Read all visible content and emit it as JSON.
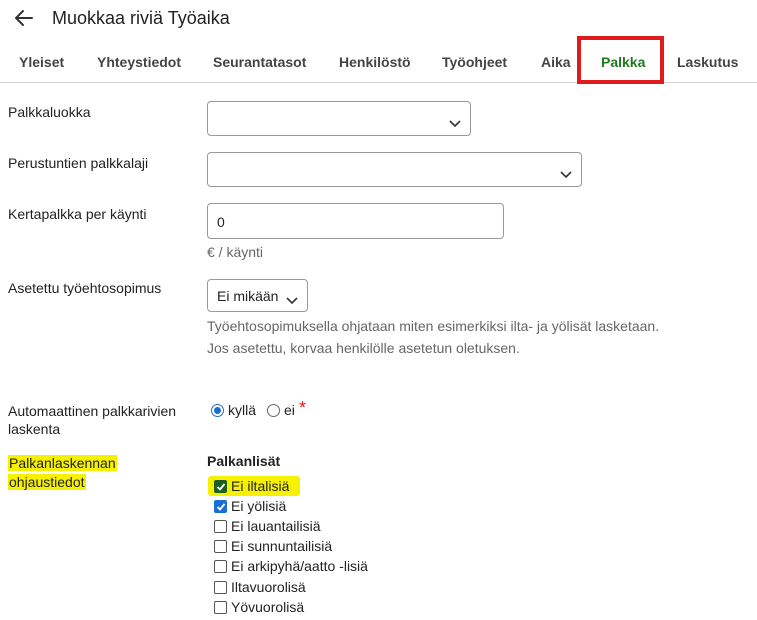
{
  "header": {
    "title": "Muokkaa riviä Työaika",
    "back_icon": "arrow-left-icon"
  },
  "tabs": [
    {
      "label": "Yleiset",
      "active": false
    },
    {
      "label": "Yhteystiedot",
      "active": false
    },
    {
      "label": "Seurantatasot",
      "active": false
    },
    {
      "label": "Henkilöstö",
      "active": false
    },
    {
      "label": "Työohjeet",
      "active": false
    },
    {
      "label": "Aika",
      "active": false
    },
    {
      "label": "Palkka",
      "active": true
    },
    {
      "label": "Laskutus",
      "active": false
    }
  ],
  "colors": {
    "active_tab": "#1e7a1e",
    "highlight_box": "#e11b1b",
    "marker": "#f5f100",
    "accent": "#1a6fd6"
  },
  "form": {
    "palkkaluokka": {
      "label": "Palkkaluokka",
      "value": ""
    },
    "perustuntien_palkkalaji": {
      "label": "Perustuntien palkkalaji",
      "value": ""
    },
    "kertapalkka": {
      "label": "Kertapalkka per käynti",
      "value": "0",
      "unit": "€ / käynti"
    },
    "tyoehtosopimus": {
      "label": "Asetettu työehtosopimus",
      "value": "Ei mikään",
      "help_line1": "Työehtosopimuksella ohjataan miten esimerkiksi ilta- ja yölisät lasketaan.",
      "help_line2": "Jos asetettu, korvaa henkilölle asetetun oletuksen."
    },
    "automaattinen": {
      "label_line1": "Automaattinen palkkarivien",
      "label_line2": "laskenta",
      "yes_label": "kyllä",
      "no_label": "ei",
      "selected": "kyllä",
      "required_mark": "*"
    },
    "ohjaustiedot": {
      "label_line1": "Palkanlaskennan",
      "label_line2": "ohjaustiedot",
      "group_title": "Palkanlisät",
      "items": [
        {
          "label": "Ei iltalisiä",
          "checked": true
        },
        {
          "label": "Ei yölisiä",
          "checked": true
        },
        {
          "label": "Ei lauantailisiä",
          "checked": false
        },
        {
          "label": "Ei sunnuntailisiä",
          "checked": false
        },
        {
          "label": "Ei arkipyhä/aatto -lisiä",
          "checked": false
        },
        {
          "label": "Iltavuorolisä",
          "checked": false
        },
        {
          "label": "Yövuorolisä",
          "checked": false
        }
      ]
    }
  }
}
